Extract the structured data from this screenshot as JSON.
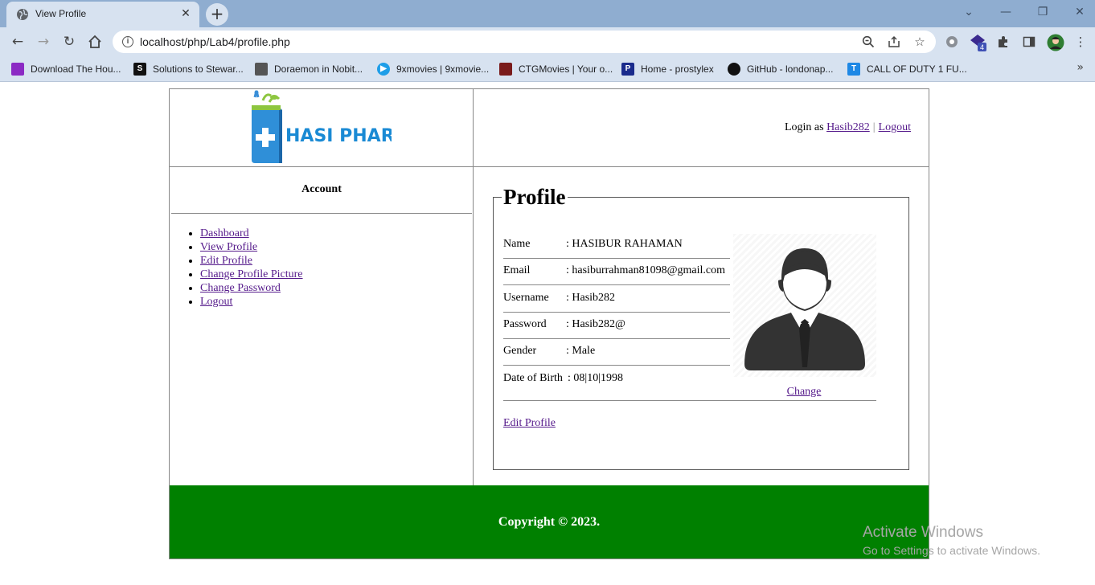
{
  "browser": {
    "tab_title": "View Profile",
    "tab_close": "✕",
    "new_tab": "+",
    "url": "localhost/php/Lab4/profile.php",
    "window_controls": {
      "dropdown": "⌄",
      "minimize": "—",
      "restore": "❐",
      "close": "✕"
    },
    "extension_badge": "4",
    "bookmarks": [
      {
        "label": "Download The Hou...",
        "icon": "youtube-icon",
        "color": "#8b2ac4"
      },
      {
        "label": "Solutions to Stewar...",
        "icon": "slader-icon",
        "color": "#111111",
        "glyph": "S"
      },
      {
        "label": "Doraemon in Nobit...",
        "icon": "image-icon",
        "color": "#555555"
      },
      {
        "label": "9xmovies | 9xmovie...",
        "icon": "play-icon",
        "color": "#1e9ee8",
        "glyph": "▶"
      },
      {
        "label": "CTGMovies | Your o...",
        "icon": "ctg-icon",
        "color": "#7a1b1b"
      },
      {
        "label": "Home - prostylex",
        "icon": "prostylex-icon",
        "color": "#1a2b8c",
        "glyph": "P"
      },
      {
        "label": "GitHub - londonap...",
        "icon": "github-icon",
        "color": "#111111"
      },
      {
        "label": "CALL OF DUTY 1 FU...",
        "icon": "t-icon",
        "color": "#1e88e5",
        "glyph": "T"
      }
    ],
    "more_bookmarks": "»"
  },
  "header": {
    "logo_text": "HASI PHARMA",
    "login_prefix": "Login as",
    "username_link": "Hasib282",
    "separator": "|",
    "logout_link": "Logout"
  },
  "sidebar": {
    "title": "Account",
    "items": [
      "Dashboard",
      "View Profile",
      "Edit Profile",
      "Change Profile Picture",
      "Change Password",
      "Logout"
    ]
  },
  "profile": {
    "legend": "Profile",
    "fields": [
      {
        "label": "Name",
        "value": ": HASIBUR RAHAMAN"
      },
      {
        "label": "Email",
        "value": ": hasiburrahman81098@gmail.com"
      },
      {
        "label": "Username",
        "value": ": Hasib282"
      },
      {
        "label": "Password",
        "value": ": Hasib282@"
      },
      {
        "label": "Gender",
        "value": ": Male"
      },
      {
        "label": "Date of Birth",
        "value": ": 08|10|1998"
      }
    ],
    "change_link": "Change",
    "edit_link": "Edit Profile"
  },
  "footer": {
    "copyright": "Copyright © 2023."
  },
  "watermark": {
    "line1": "Activate Windows",
    "line2": "Go to Settings to activate Windows."
  },
  "colors": {
    "footer_green": "#008000",
    "link_visited": "#551a8b",
    "chrome_blue": "#8fadd0"
  }
}
